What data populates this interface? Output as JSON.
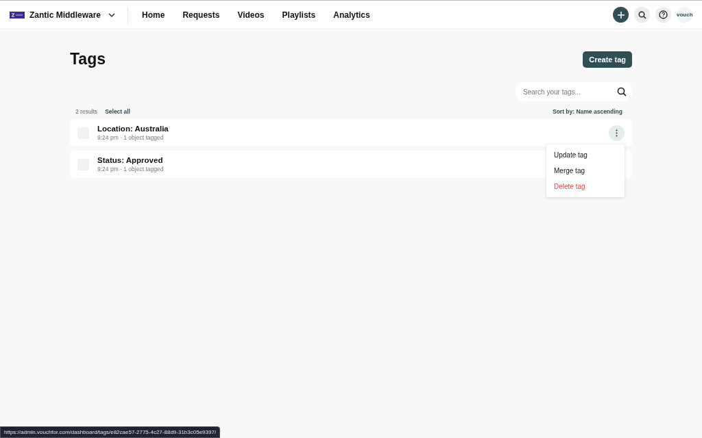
{
  "header": {
    "workspace": "Zantic Middleware",
    "nav": [
      {
        "label": "Home"
      },
      {
        "label": "Requests"
      },
      {
        "label": "Videos"
      },
      {
        "label": "Playlists"
      },
      {
        "label": "Analytics"
      }
    ],
    "account": "vouch"
  },
  "page": {
    "title": "Tags",
    "create_button": "Create tag",
    "search": {
      "placeholder": "Search your tags..."
    },
    "results_count": "2 results",
    "select_all": "Select all",
    "sort": "Sort by: Name ascending"
  },
  "rows": [
    {
      "name": "Location: Australia",
      "meta": "9:24 pm · 1 object tagged",
      "checked": false,
      "menu_open": true
    },
    {
      "name": "Status: Approved",
      "meta": "9:24 pm · 1 object tagged",
      "checked": false,
      "menu_open": false
    }
  ],
  "menu": [
    {
      "label": "Update tag",
      "kind": "normal"
    },
    {
      "label": "Merge tag",
      "kind": "normal"
    },
    {
      "label": "Delete tag",
      "kind": "danger"
    }
  ],
  "status_url": "https://admin.vouchfor.com/dashboard/tags/e82cae57-2775-4c27-88d9-31b3c05e9397/"
}
